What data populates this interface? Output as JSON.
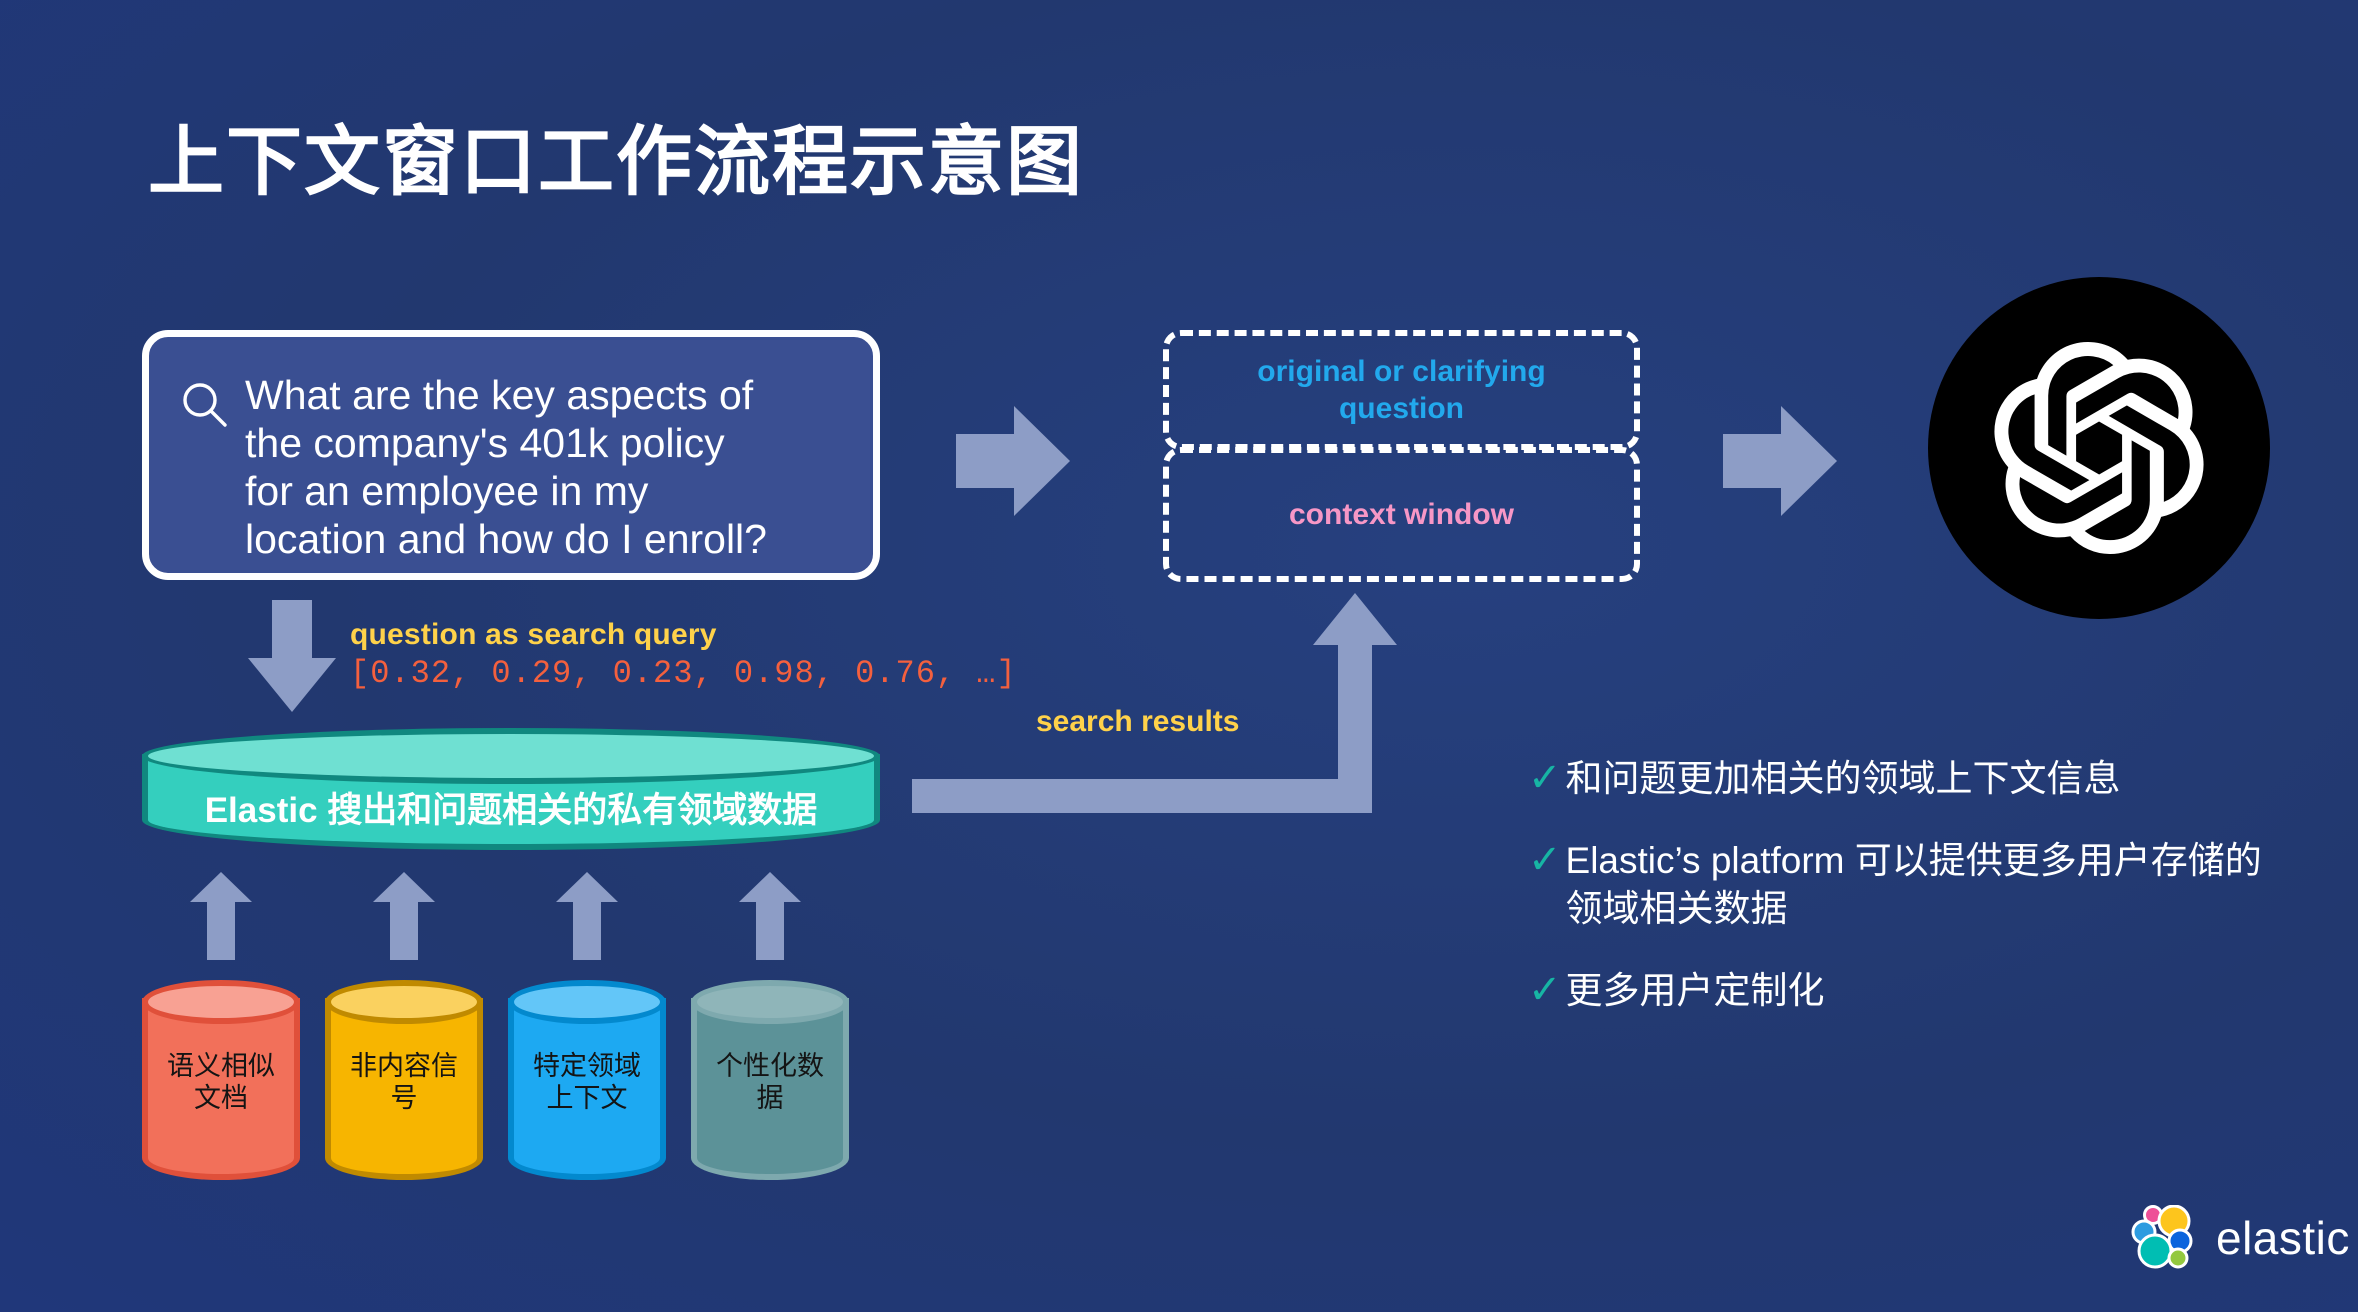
{
  "page": {
    "title": "上下文窗口工作流程示意图",
    "background_color": "#20377A"
  },
  "question_panel": {
    "icon": "search-icon",
    "text": "What are the key aspects of\nthe company's 401k policy\nfor an employee in my\nlocation and how do I enroll?"
  },
  "query_annotation": {
    "label": "question as search query",
    "label_color": "#FFD24A",
    "vector": "[0.32, 0.29, 0.23, 0.98, 0.76, …]",
    "vector_color": "#F4603E"
  },
  "elastic_store": {
    "label": "Elastic 搜出和问题相关的私有领域数据",
    "fill": "#34cfbe",
    "stroke": "#10887f",
    "top_fill": "#6fe0d2"
  },
  "sources": [
    {
      "label": "语义相似\n文档",
      "fill": "#F2705A",
      "stroke": "#E0503A",
      "top_fill": "#F8A193"
    },
    {
      "label": "非内容信\n号",
      "fill": "#F7B500",
      "stroke": "#C08A00",
      "top_fill": "#FAD15F"
    },
    {
      "label": "特定领域\n上下文",
      "fill": "#1DA9F2",
      "stroke": "#0389CE",
      "top_fill": "#63C6F8"
    },
    {
      "label": "个性化数\n据",
      "fill": "#5C9298",
      "stroke": "#7EA9AE",
      "top_fill": "#8FB5B9"
    }
  ],
  "search_results": {
    "label": "search results",
    "label_color": "#FFD24A"
  },
  "context_window": {
    "top_label": "original or clarifying\nquestion",
    "top_color": "#22A9ED",
    "bottom_label": "context window",
    "bottom_color": "#F797C6"
  },
  "llm": {
    "icon": "openai-logo-icon",
    "background": "#000000"
  },
  "benefits": [
    {
      "check": "✓",
      "text": "和问题更加相关的领域上下文信息"
    },
    {
      "check": "✓",
      "text": "Elastic’s platform 可以提供更多用户存储的领域相关数据"
    },
    {
      "check": "✓",
      "text": "更多用户定制化"
    }
  ],
  "brand": {
    "name": "elastic",
    "icon": "elastic-logo-icon"
  },
  "arrows": {
    "color": "#8d9dc6",
    "question_to_context": "arrow-right",
    "context_to_llm": "arrow-right",
    "question_to_store": "arrow-down",
    "sources_to_store": "arrow-up",
    "store_to_context": "elbow-arrow-up"
  }
}
